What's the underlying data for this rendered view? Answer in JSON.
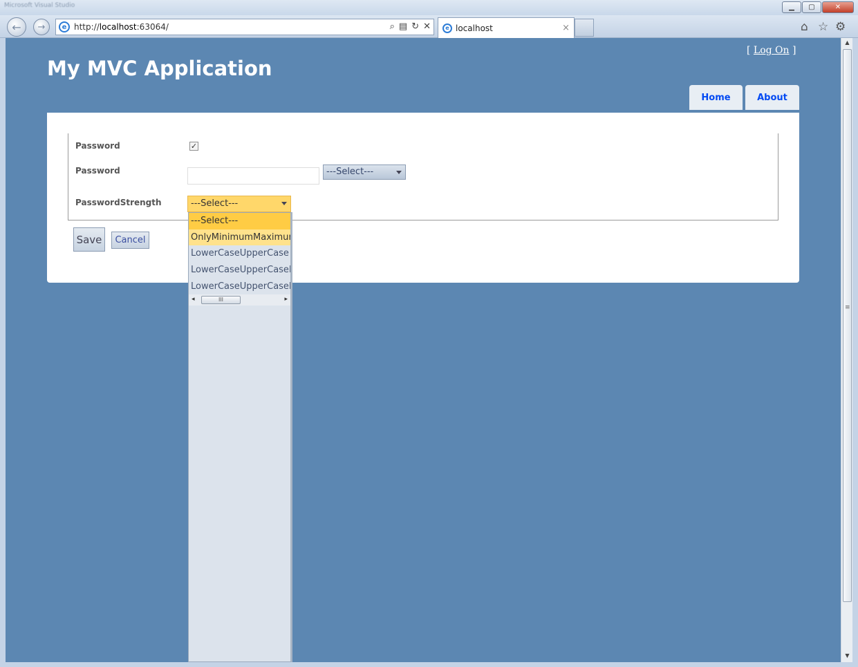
{
  "window": {
    "title": "Microsoft Visual Studio",
    "minimize": "▁",
    "maximize": "▢",
    "close": "✕"
  },
  "browser": {
    "url_prefix": "http://",
    "url_host": "localhost",
    "url_rest": ":63064/",
    "tab_title": "localhost",
    "tab_close": "×",
    "icons": [
      "back-arrow-icon",
      "forward-arrow-icon",
      "search-icon",
      "compat-view-icon",
      "refresh-icon",
      "stop-icon",
      "home-icon",
      "favorites-star-icon",
      "gear-icon"
    ]
  },
  "site": {
    "title": "My MVC Application",
    "logon_open": "[ ",
    "logon_link": "Log On",
    "logon_close": " ]",
    "menu": [
      {
        "label": "Home"
      },
      {
        "label": "About"
      }
    ]
  },
  "form": {
    "checkbox_label": "Password",
    "checkbox_checked": true,
    "password_label": "Password",
    "password_value": "",
    "password_select_value": "---Select---",
    "strength_label": "PasswordStrength",
    "strength_select_value": "---Select---",
    "save_label": "Save",
    "cancel_label": "Cancel"
  },
  "dropdown": {
    "options": [
      "---Select---",
      "OnlyMinimumMaximumL",
      "LowerCaseUpperCase",
      "LowerCaseUpperCaseNu",
      "LowerCaseUpperCaseNu"
    ],
    "selected_index": 0,
    "hover_index": 1,
    "scroll_grip": "III"
  }
}
